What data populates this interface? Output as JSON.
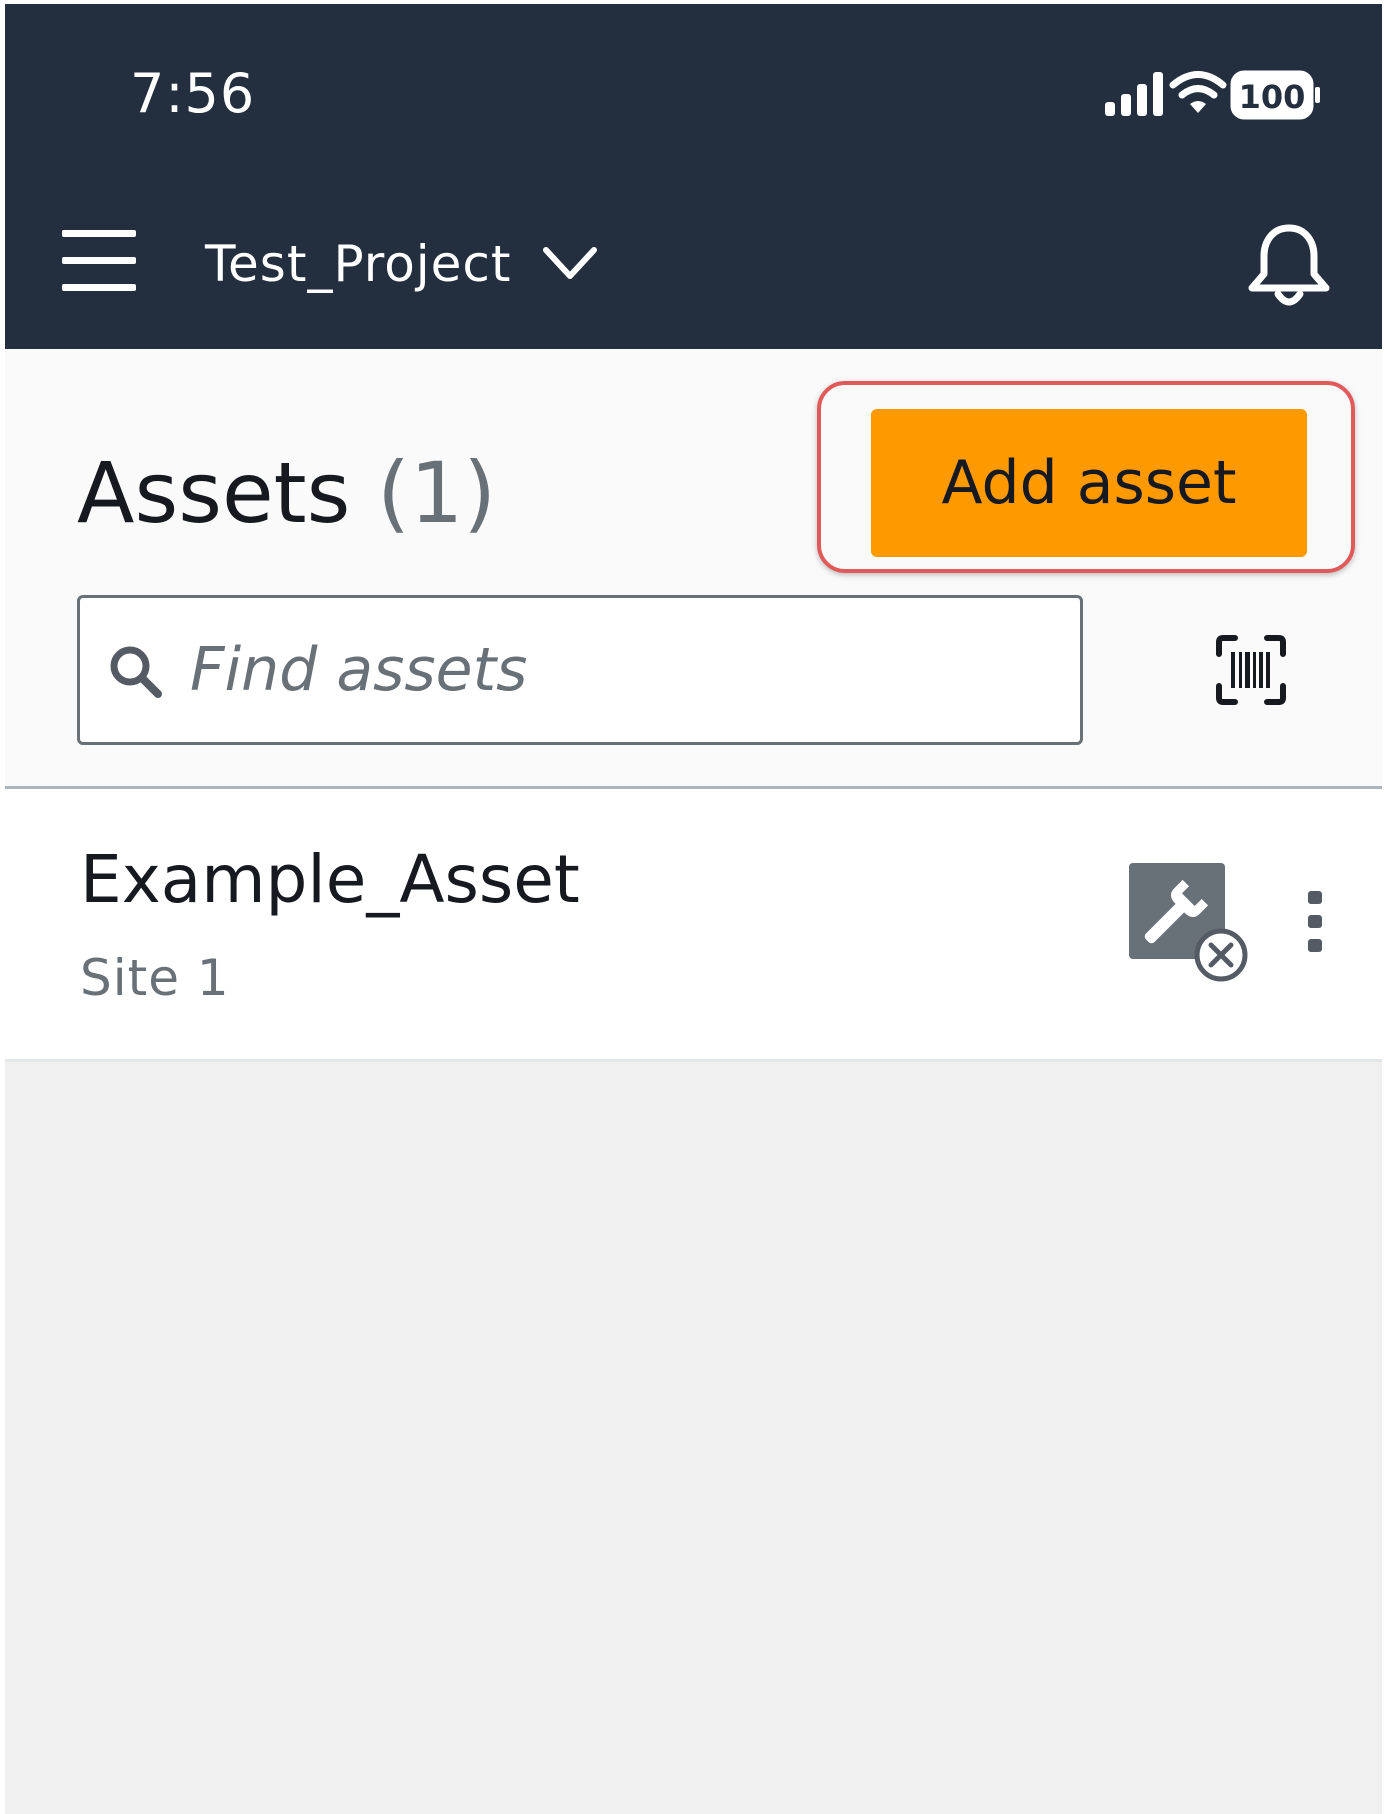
{
  "status_bar": {
    "time": "7:56",
    "battery": "100",
    "icons": [
      "signal-icon",
      "wifi-icon",
      "battery-icon"
    ]
  },
  "app_bar": {
    "project_name": "Test_Project",
    "icons": [
      "menu-icon",
      "chevron-down-icon",
      "bell-icon"
    ]
  },
  "header": {
    "title": "Assets",
    "count": "(1)",
    "add_button_label": "Add asset",
    "search_placeholder": "Find assets",
    "icons": [
      "search-icon",
      "barcode-scan-icon"
    ]
  },
  "assets": [
    {
      "name": "Example_Asset",
      "site": "Site 1",
      "status_icon": "wrench-disconnected-icon",
      "menu_icon": "more-vertical-icon"
    }
  ],
  "colors": {
    "app_bar": "#232f3e",
    "primary_button": "#ff9900",
    "highlight": "#e05a5a",
    "text_primary": "#16191f",
    "text_secondary": "#687078"
  }
}
